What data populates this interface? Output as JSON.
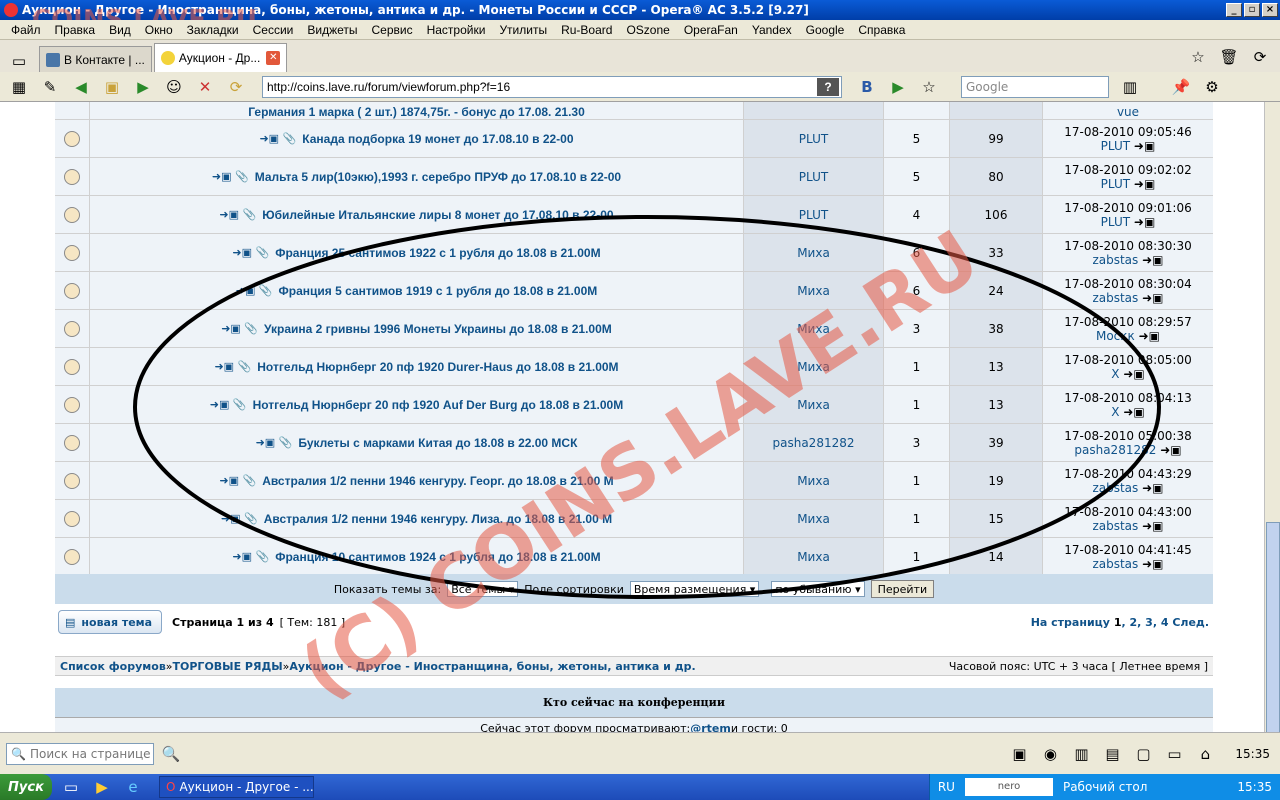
{
  "window": {
    "title": "Аукцион - Другое - Иностранщина, боны, жетоны, антика и др. - Монеты России и СССР - Opera® AC 3.5.2 [9.27]"
  },
  "menu": [
    "Файл",
    "Правка",
    "Вид",
    "Окно",
    "Закладки",
    "Сессии",
    "Виджеты",
    "Сервис",
    "Настройки",
    "Утилиты",
    "Ru-Board",
    "OSzone",
    "OperaFan",
    "Yandex",
    "Google",
    "Справка"
  ],
  "tabs": [
    {
      "label": "В Контакте | ...",
      "active": false
    },
    {
      "label": "Аукцион - Др...",
      "active": true
    }
  ],
  "address": {
    "url": "http://coins.lave.ru/forum/viewforum.php?f=16",
    "search_placeholder": "Google"
  },
  "partial_row": {
    "title": "Германия 1 марка ( 2 шт.) 1874,75г. - бонус до 17.08. 21.30",
    "last_user": "vue"
  },
  "topics": [
    {
      "title": "Канада подборка 19 монет до 17.08.10 в 22-00",
      "author": "PLUT",
      "replies": "5",
      "views": "99",
      "last_date": "17-08-2010 09:05:46",
      "last_user": "PLUT"
    },
    {
      "title": "Мальта 5 лир(10экю),1993 г. серебро ПРУФ до 17.08.10 в 22-00",
      "author": "PLUT",
      "replies": "5",
      "views": "80",
      "last_date": "17-08-2010 09:02:02",
      "last_user": "PLUT"
    },
    {
      "title": "Юбилейные Итальянские лиры 8 монет до 17.08.10 в 22-00",
      "author": "PLUT",
      "replies": "4",
      "views": "106",
      "last_date": "17-08-2010 09:01:06",
      "last_user": "PLUT"
    },
    {
      "title": "Франция 25 сантимов 1922 с 1 рубля до 18.08 в 21.00М",
      "author": "Миха",
      "replies": "6",
      "views": "33",
      "last_date": "17-08-2010 08:30:30",
      "last_user": "zabstas"
    },
    {
      "title": "Франция 5 сантимов 1919 с 1 рубля до 18.08 в 21.00М",
      "author": "Миха",
      "replies": "6",
      "views": "24",
      "last_date": "17-08-2010 08:30:04",
      "last_user": "zabstas"
    },
    {
      "title": "Украина 2 гривны 1996 Монеты Украины до 18.08 в 21.00М",
      "author": "Миха",
      "replies": "3",
      "views": "38",
      "last_date": "17-08-2010 08:29:57",
      "last_user": "Москк"
    },
    {
      "title": "Нотгельд Нюрнберг 20 пф 1920 Durer-Haus до 18.08 в 21.00М",
      "author": "Миха",
      "replies": "1",
      "views": "13",
      "last_date": "17-08-2010 08:05:00",
      "last_user": "X"
    },
    {
      "title": "Нотгельд Нюрнберг 20 пф 1920 Auf Der Burg до 18.08 в 21.00М",
      "author": "Миха",
      "replies": "1",
      "views": "13",
      "last_date": "17-08-2010 08:04:13",
      "last_user": "X"
    },
    {
      "title": "Буклеты с марками Китая до 18.08 в 22.00 МСК",
      "author": "pasha281282",
      "replies": "3",
      "views": "39",
      "last_date": "17-08-2010 05:00:38",
      "last_user": "pasha281282"
    },
    {
      "title": "Австралия 1/2 пенни 1946 кенгуру. Георг. до 18.08 в 21.00 М",
      "author": "Миха",
      "replies": "1",
      "views": "19",
      "last_date": "17-08-2010 04:43:29",
      "last_user": "zabstas"
    },
    {
      "title": "Австралия 1/2 пенни 1946 кенгуру. Лиза. до 18.08 в 21.00 М",
      "author": "Миха",
      "replies": "1",
      "views": "15",
      "last_date": "17-08-2010 04:43:00",
      "last_user": "zabstas"
    },
    {
      "title": "Франция 10 сантимов 1924 с 1 рубля до 18.08 в 21.00М",
      "author": "Миха",
      "replies": "1",
      "views": "14",
      "last_date": "17-08-2010 04:41:45",
      "last_user": "zabstas"
    }
  ],
  "sort": {
    "show_label": "Показать темы за:",
    "show_value": "Все темы",
    "field_label": "Поле сортировки",
    "field_value": "Время размещения",
    "order_value": "по убыванию",
    "go": "Перейти"
  },
  "pagination": {
    "new_topic": "новая тема",
    "page_prefix": "Страница",
    "page_cur": "1",
    "page_of": "из",
    "page_total": "4",
    "topics_count": "[ Тем: 181 ]",
    "goto_label": "На страницу",
    "pages": [
      "1",
      ", ",
      "2",
      ", ",
      "3",
      ", ",
      "4"
    ],
    "next": "След."
  },
  "breadcrumbs": {
    "items": [
      "Список форумов",
      "ТОРГОВЫЕ РЯДЫ",
      "Аукцион - Другое - Иностранщина, боны, жетоны, антика и др."
    ],
    "sep": " » ",
    "timezone": "Часовой пояс: UTC + 3 часа [ Летнее время ]"
  },
  "online": {
    "title": "Кто сейчас на конференции",
    "text_pre": "Сейчас этот форум просматривают: ",
    "user": "@rtem",
    "text_post": " и гости: 0"
  },
  "watermark": {
    "main": "(C) COINS.LAVE.RU",
    "top": "COINS.LAVE.RU"
  },
  "findbar": {
    "placeholder": "Поиск на странице",
    "time": "15:35"
  },
  "taskbar": {
    "start": "Пуск",
    "window": "Аукцион - Другое - ...",
    "lang": "RU",
    "desktop": "Рабочий стол",
    "time": "15:35"
  },
  "colors": {
    "link": "#105289",
    "row_light": "#eef3f8",
    "row_dark": "#dce3eb",
    "header_bg": "#cadceb",
    "watermark": "#e65a46"
  }
}
